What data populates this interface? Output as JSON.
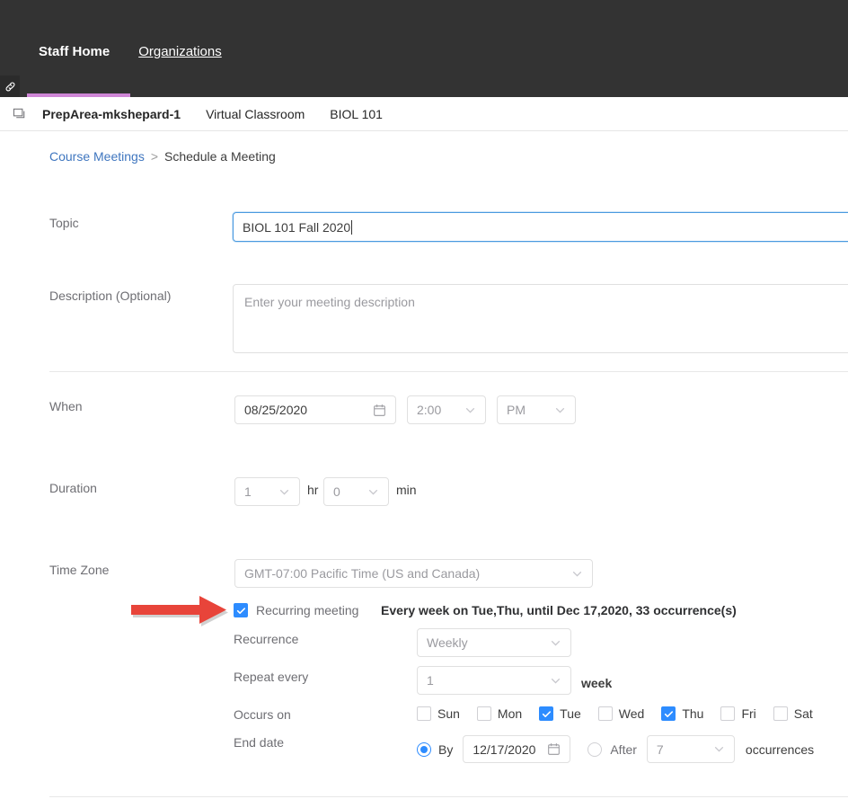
{
  "topnav": {
    "links": [
      {
        "label": "Staff Home",
        "active": true
      },
      {
        "label": "Organizations",
        "active": false
      }
    ],
    "link_icon": "link-icon",
    "accent_underline": "#cf86d6",
    "background": "#333333"
  },
  "coursebar": {
    "icon": "window-copy-icon",
    "items": [
      {
        "label": "PrepArea-mkshepard-1",
        "bold": true
      },
      {
        "label": "Virtual Classroom",
        "bold": false
      },
      {
        "label": "BIOL 101",
        "bold": false
      }
    ]
  },
  "breadcrumb": {
    "parent": "Course Meetings",
    "separator": ">",
    "current": "Schedule a Meeting",
    "link_color": "#3f76bf"
  },
  "form": {
    "topic": {
      "label": "Topic",
      "value": "BIOL 101 Fall 2020",
      "focused": true
    },
    "description": {
      "label": "Description (Optional)",
      "value": "",
      "placeholder": "Enter your meeting description"
    },
    "when": {
      "label": "When",
      "date": "08/25/2020",
      "date_icon": "calendar-icon",
      "time": "2:00",
      "meridiem": "PM"
    },
    "duration": {
      "label": "Duration",
      "hours": "1",
      "hours_unit": "hr",
      "minutes": "0",
      "minutes_unit": "min"
    },
    "timezone": {
      "label": "Time Zone",
      "value": "GMT-07:00 Pacific Time (US and Canada)"
    },
    "recurring": {
      "label": "Recurring meeting",
      "checked": true,
      "summary": "Every week on Tue,Thu, until Dec 17,2020, 33 occurrence(s)",
      "checkbox_color": "#2d8cff"
    },
    "recurrence": {
      "label": "Recurrence",
      "value": "Weekly"
    },
    "repeat_every": {
      "label": "Repeat every",
      "value": "1",
      "unit": "week"
    },
    "occurs_on": {
      "label": "Occurs on",
      "days": [
        {
          "label": "Sun",
          "checked": false
        },
        {
          "label": "Mon",
          "checked": false
        },
        {
          "label": "Tue",
          "checked": true
        },
        {
          "label": "Wed",
          "checked": false
        },
        {
          "label": "Thu",
          "checked": true
        },
        {
          "label": "Fri",
          "checked": false
        },
        {
          "label": "Sat",
          "checked": false
        }
      ]
    },
    "end_date": {
      "label": "End date",
      "by_label": "By",
      "by_selected": true,
      "by_date": "12/17/2020",
      "by_date_icon": "calendar-icon",
      "after_label": "After",
      "after_selected": false,
      "after_count": "7",
      "after_unit": "occurrences"
    }
  },
  "annotation": {
    "arrow": "red-right-arrow",
    "color": "#e8443a"
  }
}
